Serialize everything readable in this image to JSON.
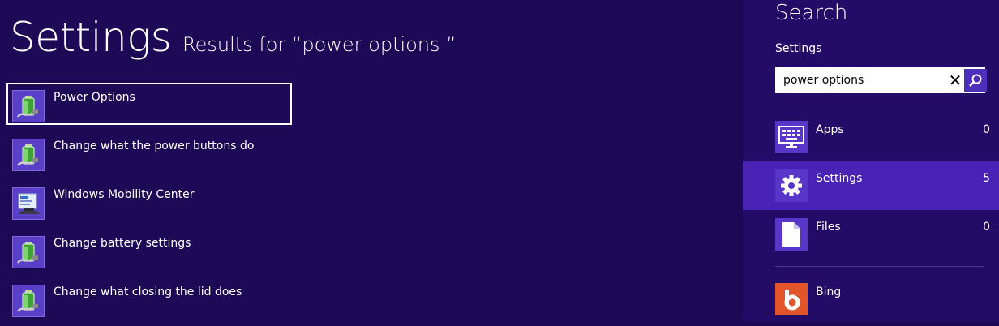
{
  "header": {
    "title": "Settings",
    "subtitle": "Results for “power options ”"
  },
  "results": [
    {
      "label": "Power Options",
      "icon": "battery-icon",
      "selected": true
    },
    {
      "label": "Change what the power buttons do",
      "icon": "battery-icon"
    },
    {
      "label": "Windows Mobility Center",
      "icon": "mobility-center-icon"
    },
    {
      "label": "Change battery settings",
      "icon": "battery-icon"
    },
    {
      "label": "Change what closing the lid does",
      "icon": "battery-icon"
    }
  ],
  "search": {
    "heading": "Search",
    "scope": "Settings",
    "query": "power options",
    "clear_glyph": "✕"
  },
  "scopes": [
    {
      "label": "Apps",
      "count": "0",
      "icon": "apps-keyboard-icon"
    },
    {
      "label": "Settings",
      "count": "5",
      "icon": "gear-icon",
      "selected": true
    },
    {
      "label": "Files",
      "count": "0",
      "icon": "file-icon"
    }
  ],
  "bing": {
    "label": "Bing",
    "icon": "bing-icon",
    "color": "#e2552b"
  },
  "colors": {
    "background": "#1c0a56",
    "pane": "#230c67",
    "selected_scope": "#4923b6",
    "icon_tile": "#5736c9"
  }
}
